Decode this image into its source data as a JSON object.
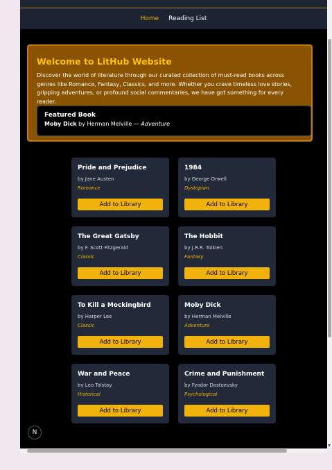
{
  "nav": {
    "items": [
      "Home",
      "Reading List"
    ]
  },
  "welcome": {
    "title": "Welcome to LitHub Website",
    "text": "Discover the world of literature through our curated collection of must-read books across genres like Romance, Fantasy, Classics, and more. Whether you crave timeless love stories, gripping adventures, or profound social commentaries, we have got something for every reader."
  },
  "featured": {
    "label": "Featured Book",
    "title": "Moby Dick",
    "by": " by Herman Melville — ",
    "genre": "Adventure"
  },
  "books": [
    {
      "title": "Pride and Prejudice",
      "author": "by Jane Austen",
      "genre": "Romance",
      "button": "Add to Library"
    },
    {
      "title": "1984",
      "author": "by George Orwell",
      "genre": "Dystopian",
      "button": "Add to Library"
    },
    {
      "title": "The Great Gatsby",
      "author": "by F. Scott Fitzgerald",
      "genre": "Classic",
      "button": "Add to Library"
    },
    {
      "title": "The Hobbit",
      "author": "by J.R.R. Tolkien",
      "genre": "Fantasy",
      "button": "Add to Library"
    },
    {
      "title": "To Kill a Mockingbird",
      "author": "by Harper Lee",
      "genre": "Classic",
      "button": "Add to Library"
    },
    {
      "title": "Moby Dick",
      "author": "by Herman Melville",
      "genre": "Adventure",
      "button": "Add to Library"
    },
    {
      "title": "War and Peace",
      "author": "by Leo Tolstoy",
      "genre": "Historical",
      "button": "Add to Library"
    },
    {
      "title": "Crime and Punishment",
      "author": "by Fyodor Dostoevsky",
      "genre": "Psychological",
      "button": "Add to Library"
    }
  ],
  "badge": {
    "letter": "N"
  },
  "colors": {
    "accent": "#f1b20b",
    "welcome_bg": "#8a5302",
    "card_bg": "#222938",
    "nav_bg": "#1c2433"
  }
}
